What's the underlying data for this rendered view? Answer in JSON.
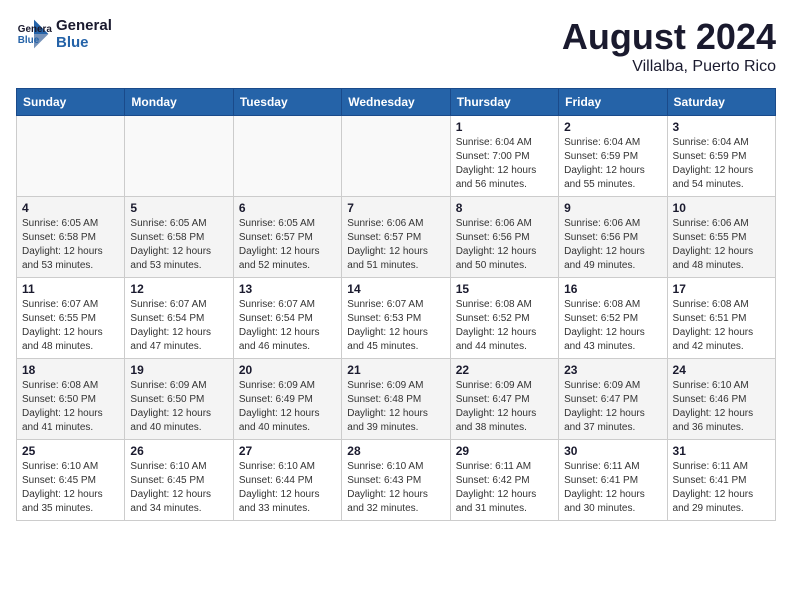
{
  "header": {
    "logo_line1": "General",
    "logo_line2": "Blue",
    "month_year": "August 2024",
    "location": "Villalba, Puerto Rico"
  },
  "weekdays": [
    "Sunday",
    "Monday",
    "Tuesday",
    "Wednesday",
    "Thursday",
    "Friday",
    "Saturday"
  ],
  "weeks": [
    [
      {
        "day": "",
        "info": ""
      },
      {
        "day": "",
        "info": ""
      },
      {
        "day": "",
        "info": ""
      },
      {
        "day": "",
        "info": ""
      },
      {
        "day": "1",
        "info": "Sunrise: 6:04 AM\nSunset: 7:00 PM\nDaylight: 12 hours\nand 56 minutes."
      },
      {
        "day": "2",
        "info": "Sunrise: 6:04 AM\nSunset: 6:59 PM\nDaylight: 12 hours\nand 55 minutes."
      },
      {
        "day": "3",
        "info": "Sunrise: 6:04 AM\nSunset: 6:59 PM\nDaylight: 12 hours\nand 54 minutes."
      }
    ],
    [
      {
        "day": "4",
        "info": "Sunrise: 6:05 AM\nSunset: 6:58 PM\nDaylight: 12 hours\nand 53 minutes."
      },
      {
        "day": "5",
        "info": "Sunrise: 6:05 AM\nSunset: 6:58 PM\nDaylight: 12 hours\nand 53 minutes."
      },
      {
        "day": "6",
        "info": "Sunrise: 6:05 AM\nSunset: 6:57 PM\nDaylight: 12 hours\nand 52 minutes."
      },
      {
        "day": "7",
        "info": "Sunrise: 6:06 AM\nSunset: 6:57 PM\nDaylight: 12 hours\nand 51 minutes."
      },
      {
        "day": "8",
        "info": "Sunrise: 6:06 AM\nSunset: 6:56 PM\nDaylight: 12 hours\nand 50 minutes."
      },
      {
        "day": "9",
        "info": "Sunrise: 6:06 AM\nSunset: 6:56 PM\nDaylight: 12 hours\nand 49 minutes."
      },
      {
        "day": "10",
        "info": "Sunrise: 6:06 AM\nSunset: 6:55 PM\nDaylight: 12 hours\nand 48 minutes."
      }
    ],
    [
      {
        "day": "11",
        "info": "Sunrise: 6:07 AM\nSunset: 6:55 PM\nDaylight: 12 hours\nand 48 minutes."
      },
      {
        "day": "12",
        "info": "Sunrise: 6:07 AM\nSunset: 6:54 PM\nDaylight: 12 hours\nand 47 minutes."
      },
      {
        "day": "13",
        "info": "Sunrise: 6:07 AM\nSunset: 6:54 PM\nDaylight: 12 hours\nand 46 minutes."
      },
      {
        "day": "14",
        "info": "Sunrise: 6:07 AM\nSunset: 6:53 PM\nDaylight: 12 hours\nand 45 minutes."
      },
      {
        "day": "15",
        "info": "Sunrise: 6:08 AM\nSunset: 6:52 PM\nDaylight: 12 hours\nand 44 minutes."
      },
      {
        "day": "16",
        "info": "Sunrise: 6:08 AM\nSunset: 6:52 PM\nDaylight: 12 hours\nand 43 minutes."
      },
      {
        "day": "17",
        "info": "Sunrise: 6:08 AM\nSunset: 6:51 PM\nDaylight: 12 hours\nand 42 minutes."
      }
    ],
    [
      {
        "day": "18",
        "info": "Sunrise: 6:08 AM\nSunset: 6:50 PM\nDaylight: 12 hours\nand 41 minutes."
      },
      {
        "day": "19",
        "info": "Sunrise: 6:09 AM\nSunset: 6:50 PM\nDaylight: 12 hours\nand 40 minutes."
      },
      {
        "day": "20",
        "info": "Sunrise: 6:09 AM\nSunset: 6:49 PM\nDaylight: 12 hours\nand 40 minutes."
      },
      {
        "day": "21",
        "info": "Sunrise: 6:09 AM\nSunset: 6:48 PM\nDaylight: 12 hours\nand 39 minutes."
      },
      {
        "day": "22",
        "info": "Sunrise: 6:09 AM\nSunset: 6:47 PM\nDaylight: 12 hours\nand 38 minutes."
      },
      {
        "day": "23",
        "info": "Sunrise: 6:09 AM\nSunset: 6:47 PM\nDaylight: 12 hours\nand 37 minutes."
      },
      {
        "day": "24",
        "info": "Sunrise: 6:10 AM\nSunset: 6:46 PM\nDaylight: 12 hours\nand 36 minutes."
      }
    ],
    [
      {
        "day": "25",
        "info": "Sunrise: 6:10 AM\nSunset: 6:45 PM\nDaylight: 12 hours\nand 35 minutes."
      },
      {
        "day": "26",
        "info": "Sunrise: 6:10 AM\nSunset: 6:45 PM\nDaylight: 12 hours\nand 34 minutes."
      },
      {
        "day": "27",
        "info": "Sunrise: 6:10 AM\nSunset: 6:44 PM\nDaylight: 12 hours\nand 33 minutes."
      },
      {
        "day": "28",
        "info": "Sunrise: 6:10 AM\nSunset: 6:43 PM\nDaylight: 12 hours\nand 32 minutes."
      },
      {
        "day": "29",
        "info": "Sunrise: 6:11 AM\nSunset: 6:42 PM\nDaylight: 12 hours\nand 31 minutes."
      },
      {
        "day": "30",
        "info": "Sunrise: 6:11 AM\nSunset: 6:41 PM\nDaylight: 12 hours\nand 30 minutes."
      },
      {
        "day": "31",
        "info": "Sunrise: 6:11 AM\nSunset: 6:41 PM\nDaylight: 12 hours\nand 29 minutes."
      }
    ]
  ]
}
